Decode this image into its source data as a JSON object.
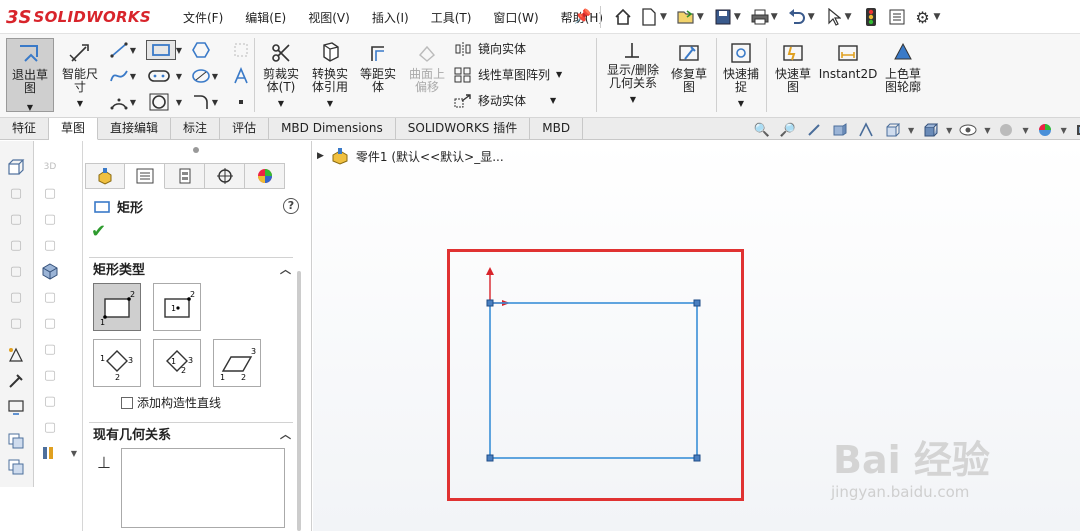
{
  "app": {
    "logo_mark": "3S",
    "logo_text": "SOLIDWORKS"
  },
  "menu": [
    "文件(F)",
    "编辑(E)",
    "视图(V)",
    "插入(I)",
    "工具(T)",
    "窗口(W)",
    "帮助(H)"
  ],
  "quick_access": [
    "home-icon",
    "new-document-icon",
    "open-icon",
    "save-icon",
    "print-icon",
    "undo-icon",
    "select-icon",
    "rebuild-icon",
    "file-properties-icon",
    "options-icon"
  ],
  "ribbon": {
    "exit_sketch": "退出草\n图",
    "smart_dimension": "智能尺\n寸",
    "trim": "剪裁实\n体(T)",
    "convert": "转换实\n体引用",
    "offset": "等距实\n体",
    "surface_offset": "曲面上\n偏移",
    "mirror": "镜向实体",
    "linear_pattern": "线性草图阵列",
    "move": "移动实体",
    "display_relations": "显示/删除\n几何关系",
    "repair": "修复草\n图",
    "quick_snaps": "快速捕\n捉",
    "rapid_sketch": "快速草\n图",
    "instant2d": "Instant2D",
    "shaded_contours": "上色草\n图轮廓"
  },
  "tabs": [
    {
      "label": "特征",
      "active": false
    },
    {
      "label": "草图",
      "active": true
    },
    {
      "label": "直接编辑",
      "active": false
    },
    {
      "label": "标注",
      "active": false
    },
    {
      "label": "评估",
      "active": false
    },
    {
      "label": "MBD Dimensions",
      "active": false
    },
    {
      "label": "SOLIDWORKS 插件",
      "active": false
    },
    {
      "label": "MBD",
      "active": false
    }
  ],
  "property_manager": {
    "title": "矩形",
    "help": "?",
    "ok": "✔",
    "group_rect_type": "矩形类型",
    "add_construction": "添加构造性直线",
    "group_relations": "现有几何关系",
    "relation_icon": "⊥"
  },
  "tree": {
    "item": "零件1  (默认<<默认>_显..."
  },
  "watermark": {
    "main": "Bai 经验",
    "sub": "jingyan.baidu.com"
  }
}
